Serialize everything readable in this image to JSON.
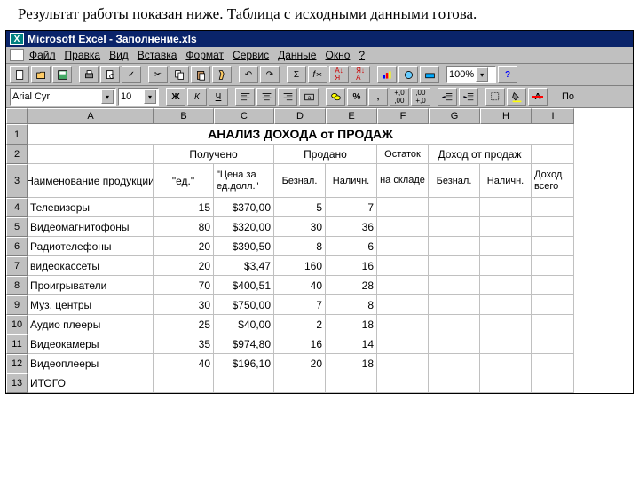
{
  "caption": "Результат работы показан ниже. Таблица с исходными данными готова.",
  "titlebar": "Microsoft Excel - Заполнение.xls",
  "menu": [
    "Файл",
    "Правка",
    "Вид",
    "Вставка",
    "Формат",
    "Сервис",
    "Данные",
    "Окно",
    "?"
  ],
  "font": {
    "name": "Arial Cyr",
    "size": "10"
  },
  "zoom": "100%",
  "fmtBtns": {
    "bold": "Ж",
    "italic": "К",
    "underline": "Ч",
    "percent": "%",
    "comma": ",",
    "po": "По"
  },
  "cols": [
    "A",
    "B",
    "C",
    "D",
    "E",
    "F",
    "G",
    "H",
    "I"
  ],
  "rownums": [
    "1",
    "2",
    "3",
    "4",
    "5",
    "6",
    "7",
    "8",
    "9",
    "10",
    "11",
    "12",
    "13"
  ],
  "head": {
    "title": "АНАЛИЗ ДОХОДА от ПРОДАЖ",
    "name": "Наименование продукции",
    "got": "Получено",
    "sold": "Продано",
    "stock": "Остаток на складе",
    "income": "Доход от продаж",
    "qty": "\"ед.\"",
    "price": "\"Цена за ед.долл.\"",
    "beznal": "Безнал.",
    "nalich": "Наличн.",
    "vsego": "Доход всего"
  },
  "chart_data": {
    "type": "table",
    "columns": [
      "Наименование продукции",
      "Получено ед.",
      "Цена за ед.долл.",
      "Продано Безнал.",
      "Продано Наличн."
    ],
    "rows": [
      [
        "Телевизоры",
        15,
        "$370,00",
        5,
        7
      ],
      [
        "Видеомагнитофоны",
        80,
        "$320,00",
        30,
        36
      ],
      [
        "Радиотелефоны",
        20,
        "$390,50",
        8,
        6
      ],
      [
        "видеокассеты",
        20,
        "$3,47",
        160,
        16
      ],
      [
        "Проигрыватели",
        70,
        "$400,51",
        40,
        28
      ],
      [
        "Муз. центры",
        30,
        "$750,00",
        7,
        8
      ],
      [
        "Аудио плееры",
        25,
        "$40,00",
        2,
        18
      ],
      [
        "Видеокамеры",
        35,
        "$974,80",
        16,
        14
      ],
      [
        "Видеоплееры",
        40,
        "$196,10",
        20,
        18
      ]
    ],
    "footer": "ИТОГО"
  }
}
